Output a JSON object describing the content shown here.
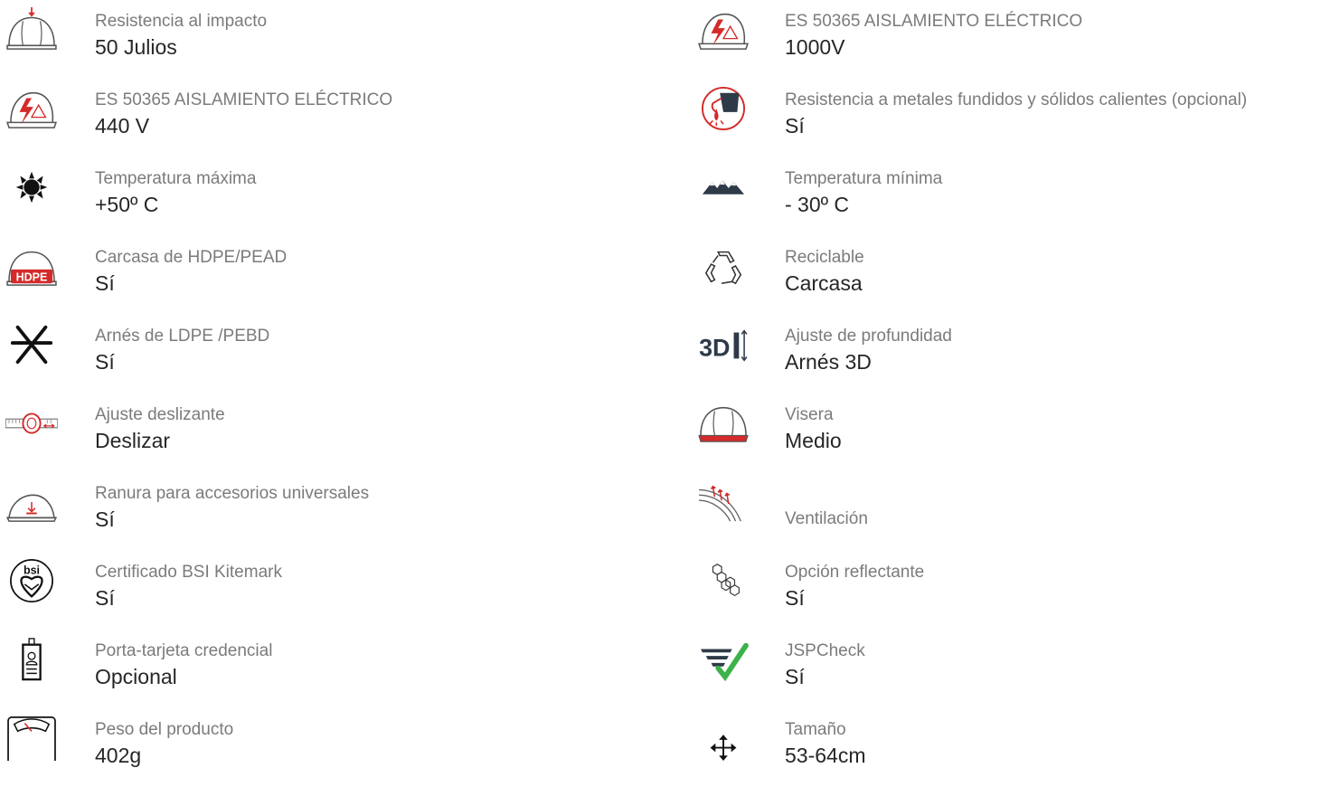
{
  "colors": {
    "label": "#7b7b7b",
    "value": "#262626",
    "accent_red": "#d42a2a",
    "icon_dark": "#2e3a48",
    "check_green": "#3bb34a"
  },
  "left": [
    {
      "label": "Resistencia al impacto",
      "value": "50 Julios",
      "icon": "helmet-impact-icon"
    },
    {
      "label": "ES 50365 AISLAMIENTO ELÉCTRICO",
      "value": "440 V",
      "icon": "electrical-insulation-icon"
    },
    {
      "label": "Temperatura máxima",
      "value": "+50º C",
      "icon": "sun-icon"
    },
    {
      "label": "Carcasa de HDPE/PEAD",
      "value": "Sí",
      "icon": "hdpe-helmet-icon",
      "icon_text": "HDPE"
    },
    {
      "label": "Arnés de LDPE /PEBD",
      "value": "Sí",
      "icon": "harness-icon"
    },
    {
      "label": "Ajuste deslizante",
      "value": "Deslizar",
      "icon": "slide-adjust-icon"
    },
    {
      "label": "Ranura para accesorios universales",
      "value": "Sí",
      "icon": "accessory-slot-icon"
    },
    {
      "label": "Certificado BSI Kitemark",
      "value": "Sí",
      "icon": "bsi-kitemark-icon",
      "icon_text": "bsi"
    },
    {
      "label": "Porta-tarjeta credencial",
      "value": "Opcional",
      "icon": "badge-holder-icon"
    },
    {
      "label": "Peso del producto",
      "value": "402g",
      "icon": "weight-scale-icon"
    }
  ],
  "right": [
    {
      "label": "ES 50365 AISLAMIENTO ELÉCTRICO",
      "value": "1000V",
      "icon": "electrical-insulation-icon"
    },
    {
      "label": "Resistencia a metales fundidos y sólidos calientes (opcional)",
      "value": "Sí",
      "icon": "molten-metal-icon"
    },
    {
      "label": "Temperatura mínima",
      "value": "- 30º C",
      "icon": "mountains-icon"
    },
    {
      "label": "Reciclable",
      "value": "Carcasa",
      "icon": "recycle-icon"
    },
    {
      "label": "Ajuste de profundidad",
      "value": "Arnés 3D",
      "icon": "depth-3d-icon",
      "icon_text": "3D"
    },
    {
      "label": "Visera",
      "value": "Medio",
      "icon": "visor-helmet-icon"
    },
    {
      "label": "Ventilación",
      "value": "",
      "icon": "ventilation-icon"
    },
    {
      "label": "Opción reflectante",
      "value": "Sí",
      "icon": "reflective-icon"
    },
    {
      "label": "JSPCheck",
      "value": "Sí",
      "icon": "jspcheck-icon"
    },
    {
      "label": "Tamaño",
      "value": "53-64cm",
      "icon": "size-arrows-icon"
    }
  ]
}
